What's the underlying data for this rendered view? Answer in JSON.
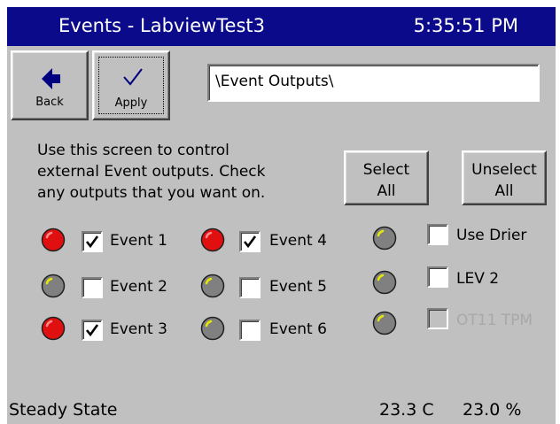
{
  "window": {
    "title": "Events - LabviewTest3",
    "time": "5:35:51 PM"
  },
  "toolbar": {
    "back_label": "Back",
    "apply_label": "Apply"
  },
  "path_field": {
    "value": "\\Event Outputs\\"
  },
  "instructions": {
    "line1": "Use this screen to control",
    "line2": "external Event outputs.  Check",
    "line3": "any outputs that you want on."
  },
  "buttons": {
    "select_all": {
      "line1": "Select",
      "line2": "All"
    },
    "unselect_all": {
      "line1": "Unselect",
      "line2": "All"
    }
  },
  "events": [
    {
      "label": "Event 1",
      "checked": true,
      "led": "red"
    },
    {
      "label": "Event 2",
      "checked": false,
      "led": "gray"
    },
    {
      "label": "Event 3",
      "checked": true,
      "led": "red"
    },
    {
      "label": "Event 4",
      "checked": true,
      "led": "red"
    },
    {
      "label": "Event 5",
      "checked": false,
      "led": "gray"
    },
    {
      "label": "Event 6",
      "checked": false,
      "led": "gray"
    }
  ],
  "options": [
    {
      "label": "Use Drier",
      "checked": false,
      "enabled": true,
      "led": "gray"
    },
    {
      "label": "LEV 2",
      "checked": false,
      "enabled": true,
      "led": "gray"
    },
    {
      "label": "OT11 TPM",
      "checked": false,
      "enabled": false,
      "led": "gray"
    }
  ],
  "status": {
    "state": "Steady State",
    "temperature": "23.3 C",
    "humidity": "23.0 %"
  },
  "colors": {
    "title_bar": "#0a0a8a",
    "panel": "#c0c0c0",
    "led_on": "#e01010",
    "led_off": "#808080"
  },
  "icons": {
    "back": "arrow-left-icon",
    "apply": "checkmark-icon"
  }
}
